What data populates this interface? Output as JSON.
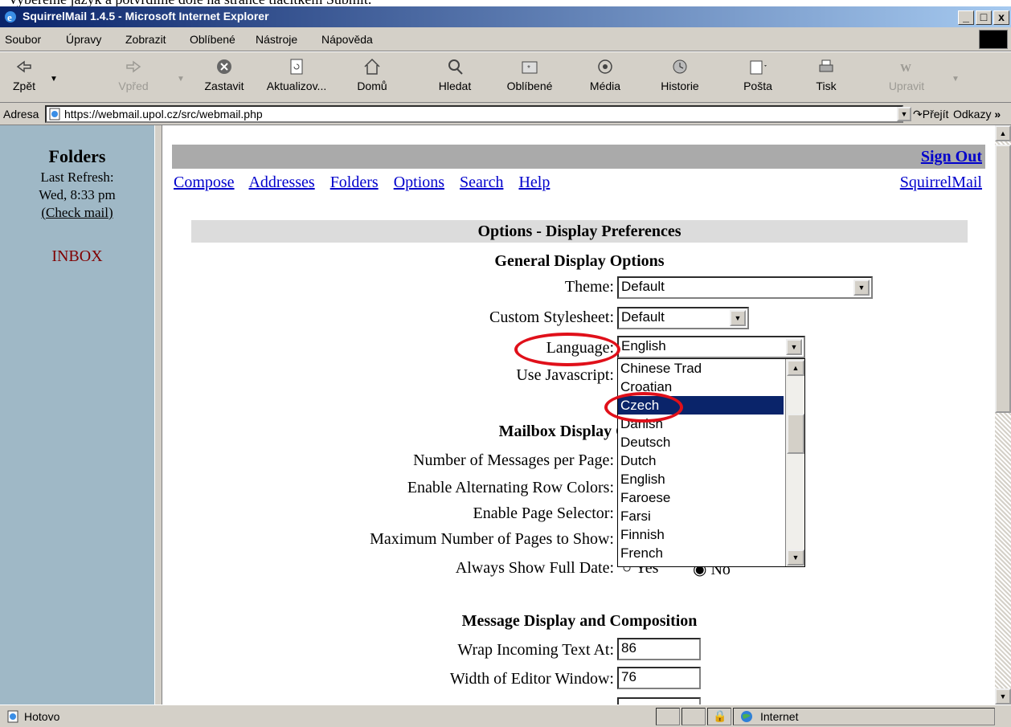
{
  "caption": "Vybereme jazyk a potvrdíme dole na stránce tlačítkem Submit.",
  "window": {
    "title": "SquirrelMail 1.4.5 - Microsoft Internet Explorer",
    "min": "_",
    "max": "□",
    "close": "x"
  },
  "menu": [
    "Soubor",
    "Úpravy",
    "Zobrazit",
    "Oblíbené",
    "Nástroje",
    "Nápověda"
  ],
  "toolbar": {
    "back": "Zpět",
    "forward": "Vpřed",
    "stop": "Zastavit",
    "refresh": "Aktualizov...",
    "home": "Domů",
    "search": "Hledat",
    "favorites": "Oblíbené",
    "media": "Média",
    "history": "Historie",
    "mail": "Pošta",
    "print": "Tisk",
    "edit": "Upravit"
  },
  "address": {
    "label": "Adresa",
    "url": "https://webmail.upol.cz/src/webmail.php",
    "go": "Přejít",
    "links": "Odkazy"
  },
  "left": {
    "title": "Folders",
    "refresh_label": "Last Refresh:",
    "refresh_time": "Wed, 8:33 pm",
    "check": "(Check mail)",
    "inbox": "INBOX"
  },
  "nav": {
    "compose": "Compose",
    "addresses": "Addresses",
    "folders": "Folders",
    "options": "Options",
    "search": "Search",
    "help": "Help",
    "signout": "Sign Out",
    "brand": "SquirrelMail"
  },
  "options": {
    "header": "Options - Display Preferences",
    "general": "General Display Options",
    "theme_label": "Theme:",
    "theme_value": "Default",
    "stylesheet_label": "Custom Stylesheet:",
    "stylesheet_value": "Default",
    "language_label": "Language:",
    "language_value": "English",
    "javascript_label": "Use Javascript:",
    "mailbox": "Mailbox Display Options",
    "per_page_label": "Number of Messages per Page:",
    "alt_colors_label": "Enable Alternating Row Colors:",
    "page_selector_label": "Enable Page Selector:",
    "max_pages_label": "Maximum Number of Pages to Show:",
    "full_date_label": "Always Show Full Date:",
    "yes": "Yes",
    "no": "No",
    "message": "Message Display and Composition",
    "wrap_label": "Wrap Incoming Text At:",
    "wrap_value": "86",
    "editor_label": "Width of Editor Window:",
    "editor_value": "76"
  },
  "language_list": [
    "Chinese Trad",
    "Croatian",
    "Czech",
    "Danish",
    "Deutsch",
    "Dutch",
    "English",
    "Faroese",
    "Farsi",
    "Finnish",
    "French"
  ],
  "language_selected": "Czech",
  "status": {
    "text": "Hotovo",
    "zone": "Internet"
  },
  "colors": {
    "titlebar": "#0a246a",
    "left_frame": "#9fb8c6",
    "link": "#0000cc",
    "inbox": "#800000",
    "highlight": "#e0101a",
    "selection": "#0a246a"
  }
}
